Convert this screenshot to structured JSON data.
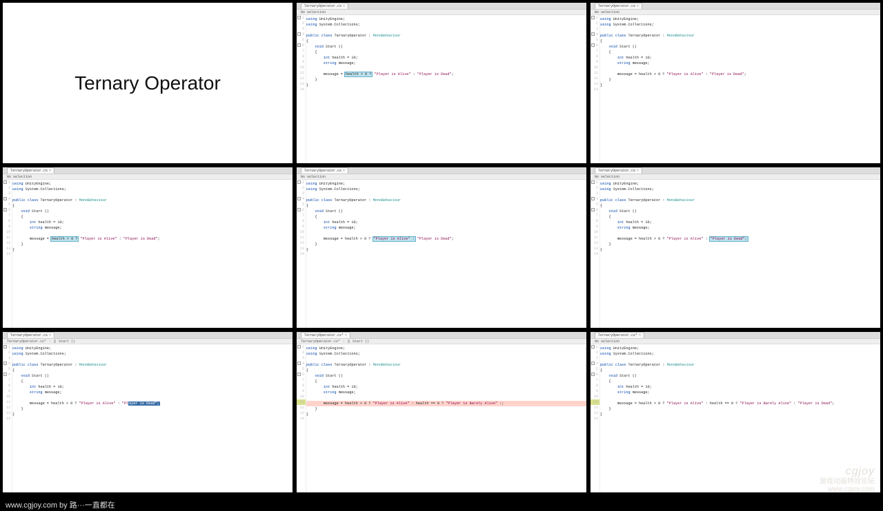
{
  "title_slide": "Ternary Operator",
  "tab": {
    "label": "TernaryOperator.cs",
    "label_dirty": "TernaryOperator.cs*",
    "close": "×"
  },
  "subbar": {
    "no_selection": "No selection",
    "crumb_file": "TernaryOperator.cs*",
    "crumb_method": "Start ()",
    "method_icon": "⨀"
  },
  "line_numbers": [
    "1",
    "2",
    "3",
    "4",
    "5",
    "6",
    "7",
    "8",
    "9",
    "10",
    "11",
    "12",
    "13",
    "14"
  ],
  "kw": {
    "using": "using",
    "public": "public",
    "class": "class",
    "void": "void",
    "int": "int",
    "string": "string"
  },
  "ns": {
    "ue": "UnityEngine",
    "sc": "System.Collections"
  },
  "types": {
    "base": "MonoBehaviour",
    "cls": "TernaryOperator"
  },
  "code": {
    "using1": ";",
    "using2": ";",
    "classline_pre": " : ",
    "brace_open": "{",
    "brace_close": "}",
    "start_decl": " Start ()",
    "health_decl": " health = ",
    "health_val": "10",
    "semi": ";",
    "msg_decl": " message;",
    "assign_pre": "message = ",
    "cond": "health > 0 ?",
    "str_alive": "\"Player is Alive\"",
    "str_dead": "\"Player is Dead\"",
    "colon": " : ",
    "nested_mid": " : health == 0 ? ",
    "str_barely": "\"Player is Barely Alive\"",
    "nested_colon_end": " : ",
    "trunc_end": " :;"
  },
  "footer": "www.cgjoy.com by 路···一直都在",
  "watermark": {
    "logo": "cgjoy",
    "tagline": "游戏动画特效论坛",
    "url": "www.cgjoy.com"
  }
}
